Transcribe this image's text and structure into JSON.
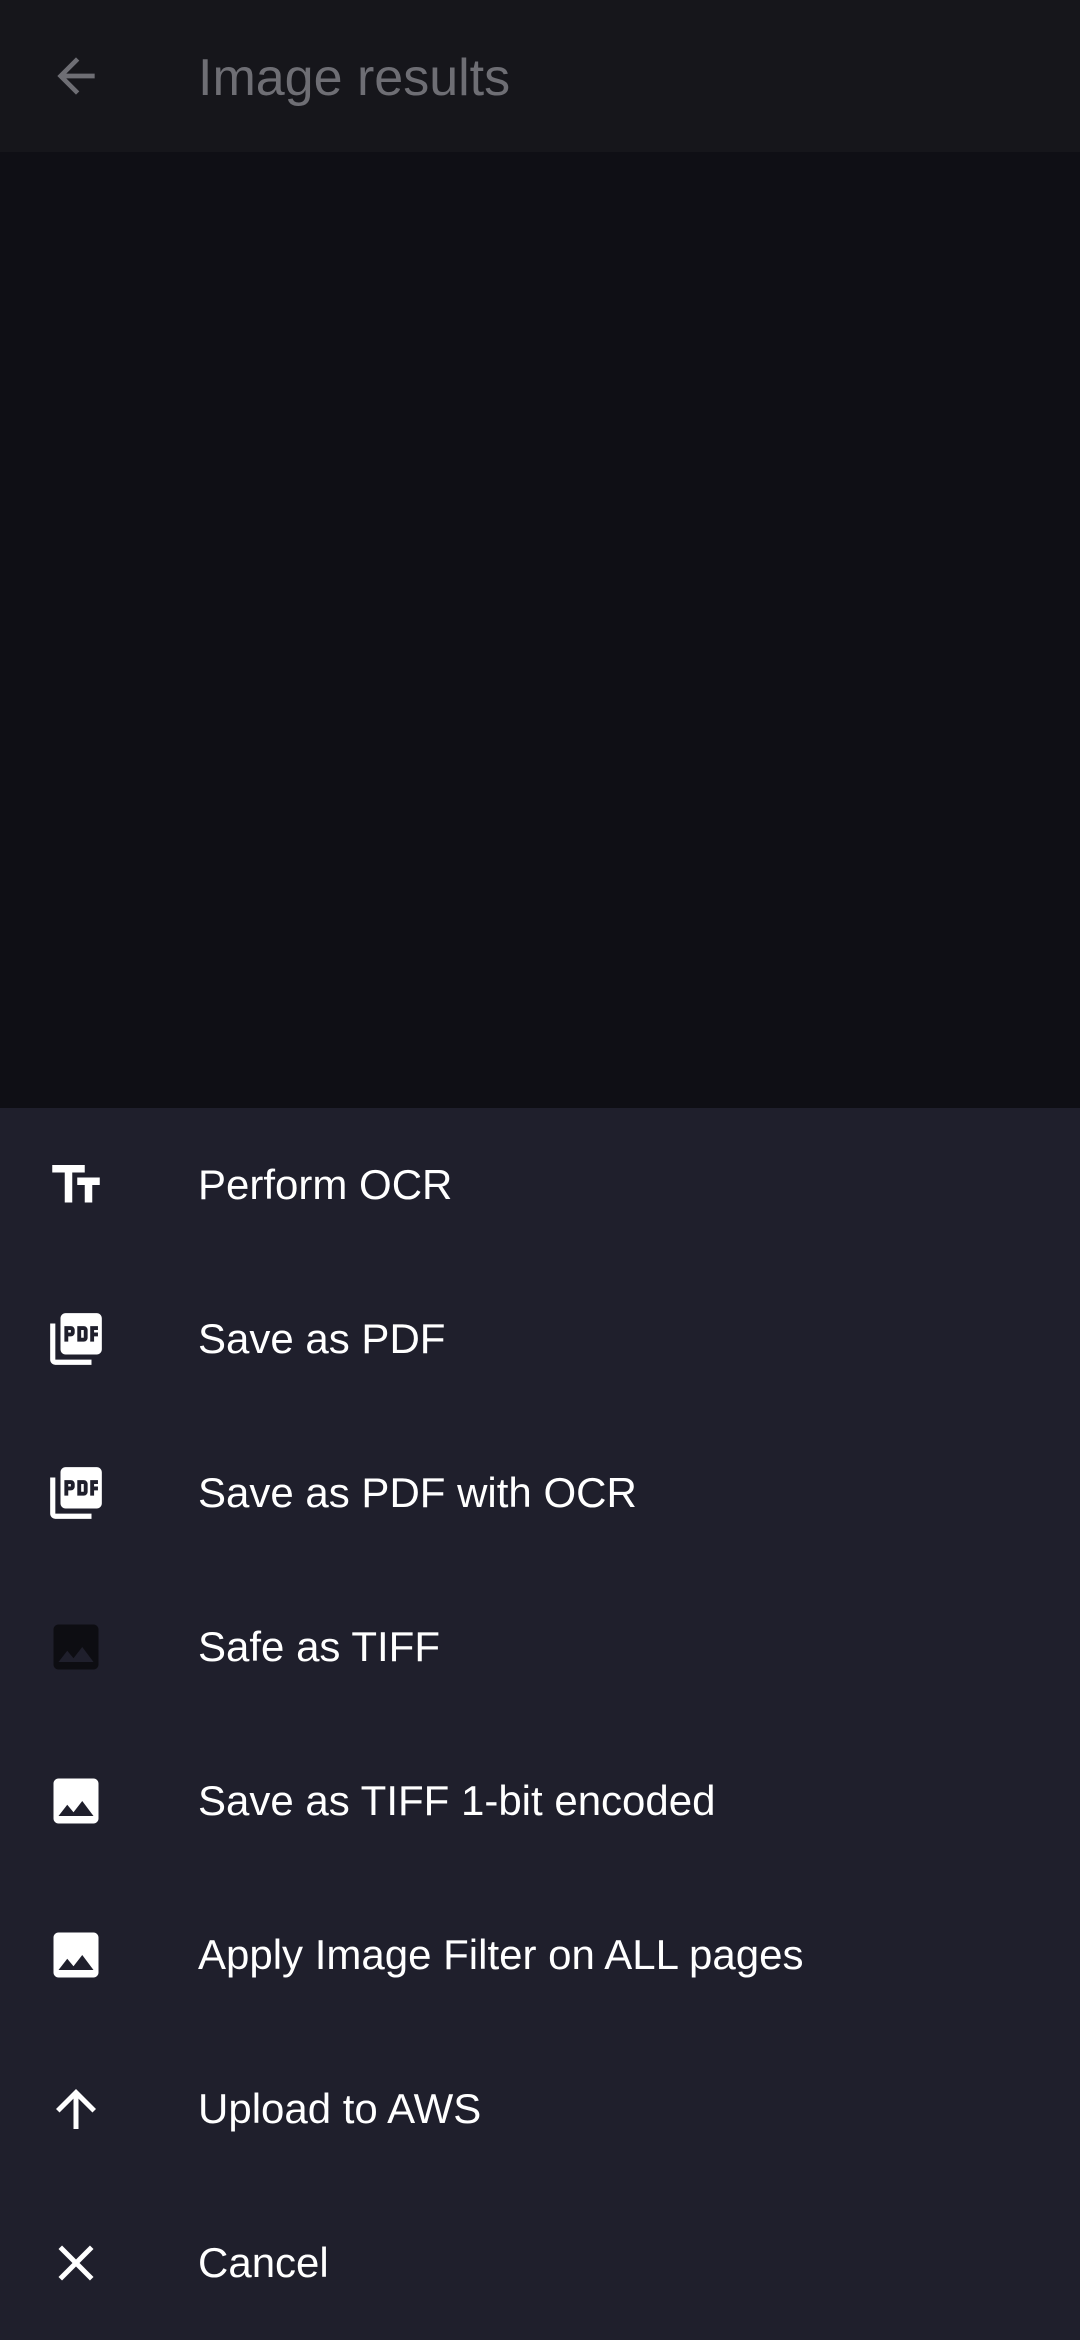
{
  "app_bar": {
    "title": "Image results",
    "back_icon": "arrow-back-icon"
  },
  "menu": {
    "items": [
      {
        "label": "Perform OCR",
        "icon": "text-fields-icon"
      },
      {
        "label": "Save as PDF",
        "icon": "picture-as-pdf-icon"
      },
      {
        "label": "Save as PDF with OCR",
        "icon": "picture-as-pdf-icon"
      },
      {
        "label": "Safe as TIFF",
        "icon": "image-icon-dimmed"
      },
      {
        "label": "Save as TIFF 1-bit encoded",
        "icon": "image-icon"
      },
      {
        "label": "Apply Image Filter on ALL pages",
        "icon": "image-icon"
      },
      {
        "label": "Upload to AWS",
        "icon": "arrow-upward-icon"
      },
      {
        "label": "Cancel",
        "icon": "close-icon"
      }
    ]
  },
  "colors": {
    "app_bar_bg": "#16161b",
    "content_bg": "#0f0f15",
    "sheet_bg": "#1f1f2c",
    "text": "#ffffff",
    "title_text": "#6e6e74"
  }
}
